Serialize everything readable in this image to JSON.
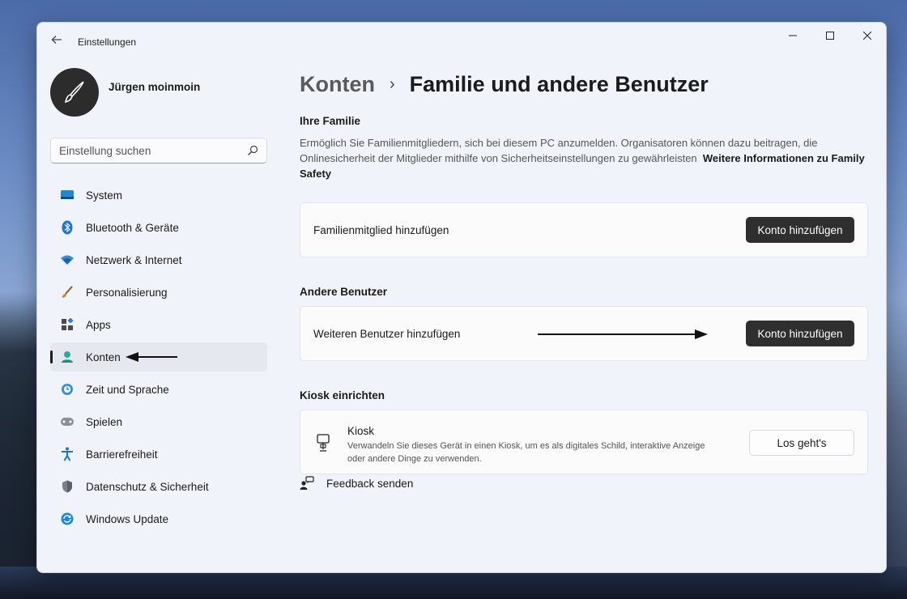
{
  "window": {
    "title": "Einstellungen"
  },
  "profile": {
    "name": "Jürgen moinmoin"
  },
  "search": {
    "placeholder": "Einstellung suchen"
  },
  "sidebar": {
    "items": [
      {
        "label": "System",
        "icon": "monitor-icon"
      },
      {
        "label": "Bluetooth & Geräte",
        "icon": "bluetooth-icon"
      },
      {
        "label": "Netzwerk & Internet",
        "icon": "wifi-icon"
      },
      {
        "label": "Personalisierung",
        "icon": "brush-icon"
      },
      {
        "label": "Apps",
        "icon": "apps-icon"
      },
      {
        "label": "Konten",
        "icon": "person-icon",
        "active": true
      },
      {
        "label": "Zeit und Sprache",
        "icon": "clock-globe-icon"
      },
      {
        "label": "Spielen",
        "icon": "gamepad-icon"
      },
      {
        "label": "Barrierefreiheit",
        "icon": "accessibility-icon"
      },
      {
        "label": "Datenschutz & Sicherheit",
        "icon": "shield-icon"
      },
      {
        "label": "Windows Update",
        "icon": "update-icon"
      }
    ]
  },
  "breadcrumb": {
    "parent": "Konten",
    "separator": "›",
    "current": "Familie und andere Benutzer"
  },
  "family": {
    "heading": "Ihre Familie",
    "description": "Ermöglich Sie Familienmitgliedern, sich bei diesem PC anzumelden. Organisatoren können dazu beitragen, die Onlinesicherheit der Mitglieder mithilfe von Sicherheitseinstellungen zu gewährleisten",
    "link": "Weitere Informationen zu Family Safety",
    "card_label": "Familienmitglied hinzufügen",
    "button": "Konto hinzufügen"
  },
  "other_users": {
    "heading": "Andere Benutzer",
    "card_label": "Weiteren Benutzer hinzufügen",
    "button": "Konto hinzufügen"
  },
  "kiosk": {
    "heading": "Kiosk einrichten",
    "title": "Kiosk",
    "description": "Verwandeln Sie dieses Gerät in einen Kiosk, um es als digitales Schild, interaktive Anzeige oder andere Dinge zu verwenden.",
    "button": "Los geht's"
  },
  "feedback": {
    "label": "Feedback senden"
  },
  "colors": {
    "accent": "#0067c0",
    "button_dark": "#2f2f2f",
    "window_bg": "#f0f3f9"
  }
}
